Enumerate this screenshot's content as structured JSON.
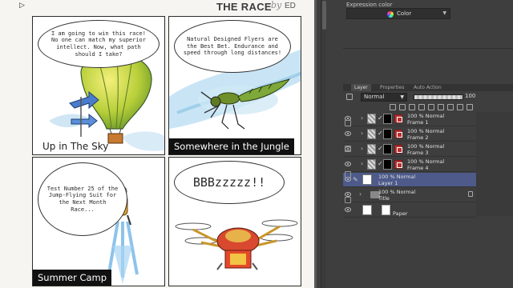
{
  "page": {
    "title": "THE RACE",
    "by": "by",
    "author": "ED"
  },
  "panels": {
    "p1": {
      "bubble": "I am going to win this race! No one can match my superior intellect. Now, what path should I take?",
      "caption": "Up in The Sky"
    },
    "p2": {
      "bubble": "Natural Designed Flyers are the Best Bet. Endurance and speed through long distances!",
      "caption": "Somewhere in the Jungle"
    },
    "p3": {
      "bubble": "Test Number 25 of the Jump-Flying Suit for the Next Month Race...",
      "caption": "Summer Camp"
    },
    "p4": {
      "bubble": "BBBzzzzz!!"
    }
  },
  "right_panel": {
    "expression_label": "Expression color",
    "expression_value": "Color",
    "tabs": [
      "Layer",
      "Properties",
      "Auto Action"
    ],
    "blend_mode": "Normal",
    "opacity": "100",
    "layers": [
      {
        "line1": "100 % Normal",
        "line2": "Frame 1"
      },
      {
        "line1": "100 % Normal",
        "line2": "Frame 2"
      },
      {
        "line1": "100 % Normal",
        "line2": "Frame 3"
      },
      {
        "line1": "100 % Normal",
        "line2": "Frame 4"
      },
      {
        "line1": "100 % Normal",
        "line2": "Layer 1"
      },
      {
        "line1": "100 % Normal",
        "line2": "Title"
      },
      {
        "line1": "",
        "line2": "Paper"
      }
    ]
  }
}
